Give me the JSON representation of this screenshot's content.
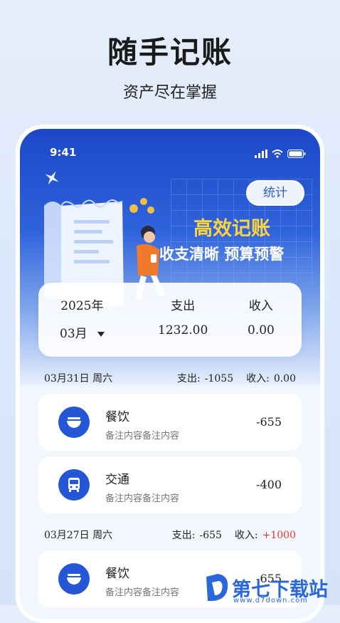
{
  "promo": {
    "title": "随手记账",
    "subtitle": "资产尽在掌握"
  },
  "status": {
    "time": "9:41"
  },
  "header": {
    "stats_button": "统计",
    "slogan_line1": "高效记账",
    "slogan_line2": "收支清晰 预算预警"
  },
  "summary": {
    "year": "2025年",
    "month": "03月",
    "expense_label": "支出",
    "expense_value": "1232.00",
    "income_label": "收入",
    "income_value": "0.00"
  },
  "days": [
    {
      "date": "03月31日 周六",
      "expense_label": "支出:",
      "expense_value": "-1055",
      "income_label": "收入:",
      "income_value": "0.00",
      "records": [
        {
          "icon": "bowl-icon",
          "category": "餐饮",
          "note": "备注内容备注内容",
          "amount": "-655"
        },
        {
          "icon": "bus-icon",
          "category": "交通",
          "note": "备注内容备注内容",
          "amount": "-400"
        }
      ]
    },
    {
      "date": "03月27日 周六",
      "expense_label": "支出:",
      "expense_value": "-655",
      "income_label": "收入:",
      "income_value": "+1000",
      "records": [
        {
          "icon": "bowl-icon",
          "category": "餐饮",
          "note": "备注内容备注内容",
          "amount": "-655"
        }
      ]
    }
  ],
  "watermark": {
    "text": "第七下载站",
    "url": "www.d7down.com"
  },
  "colors": {
    "primary": "#2556d6",
    "accent_yellow": "#ffd43b",
    "income_red": "#e0392b"
  }
}
